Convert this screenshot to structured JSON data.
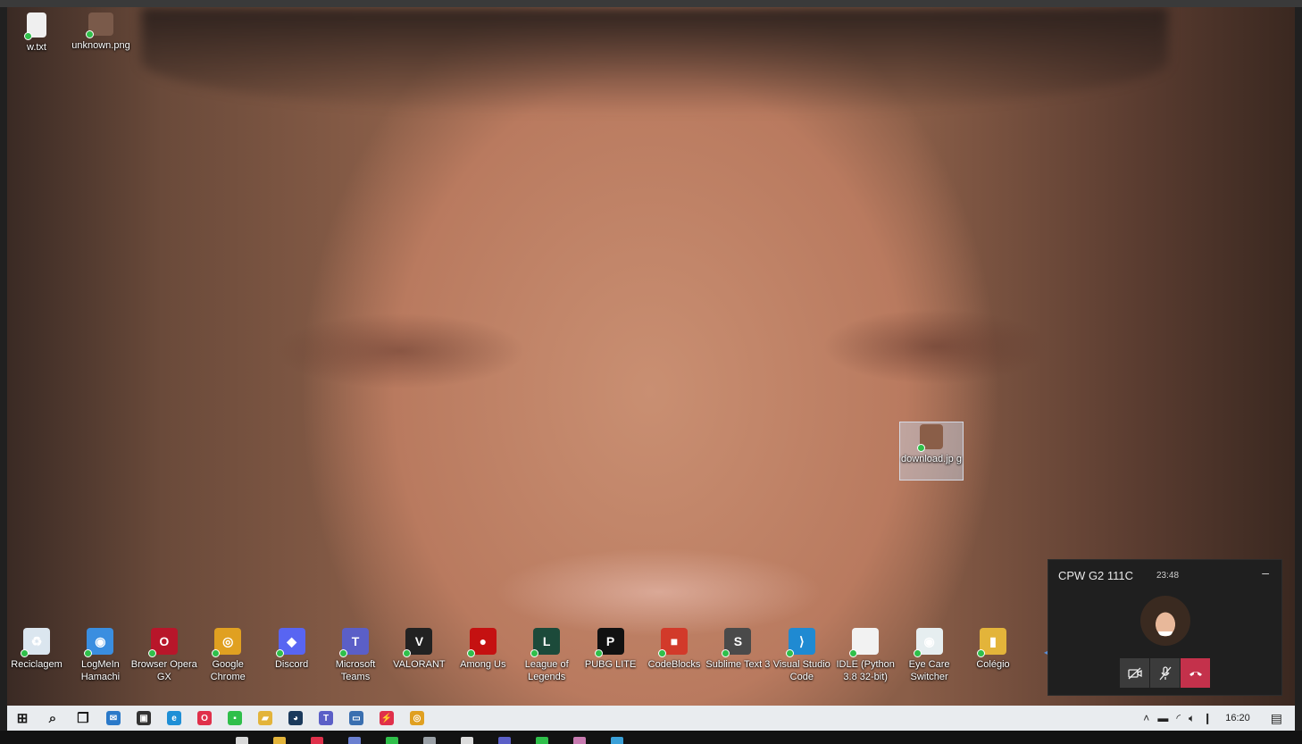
{
  "desktop": {
    "top_icons": [
      {
        "label": "w.txt",
        "icon": "text-file-icon",
        "color": "#e8e8e8"
      },
      {
        "label": "unknown.png",
        "icon": "image-file-icon",
        "color": "#7a5a4a"
      }
    ],
    "selected_file": {
      "label": "download.jp g",
      "icon": "image-file-icon"
    },
    "bottom_icons": [
      {
        "label": "Reciclagem",
        "icon": "recycle-bin-icon",
        "color": "#dbe6ef",
        "glyph": "♻"
      },
      {
        "label": "LogMeIn Hamachi",
        "icon": "hamachi-icon",
        "color": "#3a8ee0",
        "glyph": "◉"
      },
      {
        "label": "Browser Opera GX",
        "icon": "opera-gx-icon",
        "color": "#b8162a",
        "glyph": "O"
      },
      {
        "label": "Google Chrome",
        "icon": "chrome-icon",
        "color": "#e0a021",
        "glyph": "◎"
      },
      {
        "label": "Discord",
        "icon": "discord-icon",
        "color": "#5865f2",
        "glyph": "◆"
      },
      {
        "label": "Microsoft Teams",
        "icon": "teams-icon",
        "color": "#5b5fc7",
        "glyph": "T"
      },
      {
        "label": "VALORANT",
        "icon": "valorant-icon",
        "color": "#222222",
        "glyph": "V"
      },
      {
        "label": "Among Us",
        "icon": "among-us-icon",
        "color": "#c51111",
        "glyph": "●"
      },
      {
        "label": "League of Legends",
        "icon": "league-icon",
        "color": "#1c4a3a",
        "glyph": "L"
      },
      {
        "label": "PUBG LITE",
        "icon": "pubg-icon",
        "color": "#111111",
        "glyph": "P"
      },
      {
        "label": "CodeBlocks",
        "icon": "codeblocks-icon",
        "color": "#d23a2a",
        "glyph": "■"
      },
      {
        "label": "Sublime Text 3",
        "icon": "sublime-icon",
        "color": "#4a4a4a",
        "glyph": "S"
      },
      {
        "label": "Visual Studio Code",
        "icon": "vscode-icon",
        "color": "#1f8ad2",
        "glyph": "⟩"
      },
      {
        "label": "IDLE (Python 3.8 32-bit)",
        "icon": "python-file-icon",
        "color": "#f2f2f2",
        "glyph": ""
      },
      {
        "label": "Eye Care Switcher",
        "icon": "eye-care-icon",
        "color": "#e6eef0",
        "glyph": "◉"
      },
      {
        "label": "Colégio",
        "icon": "folder-icon",
        "color": "#e3b43a",
        "glyph": "▮"
      }
    ]
  },
  "taskbar": {
    "items": [
      {
        "icon": "windows-start-icon",
        "color": "#1a1a1a",
        "glyph": "⊞"
      },
      {
        "icon": "search-icon",
        "color": "#1a1a1a",
        "glyph": "⌕"
      },
      {
        "icon": "task-view-icon",
        "color": "#1a1a1a",
        "glyph": "❒"
      },
      {
        "icon": "mail-icon",
        "color": "#2a79c9",
        "glyph": "✉"
      },
      {
        "icon": "store-icon",
        "color": "#333333",
        "glyph": "▣"
      },
      {
        "icon": "edge-icon",
        "color": "#1e8fd6",
        "glyph": "e"
      },
      {
        "icon": "opera-icon",
        "color": "#e0304a",
        "glyph": "O"
      },
      {
        "icon": "app-green-icon",
        "color": "#2fbf4a",
        "glyph": "▪"
      },
      {
        "icon": "file-explorer-icon",
        "color": "#e3b43a",
        "glyph": "▰"
      },
      {
        "icon": "steam-icon",
        "color": "#1b3a5c",
        "glyph": "◕"
      },
      {
        "icon": "teams-icon",
        "color": "#5b5fc7",
        "glyph": "T"
      },
      {
        "icon": "screen-icon",
        "color": "#3a6fb0",
        "glyph": "▭"
      },
      {
        "icon": "flash-icon",
        "color": "#e0304a",
        "glyph": "⚡"
      },
      {
        "icon": "chrome-icon",
        "color": "#e0a021",
        "glyph": "◎"
      }
    ],
    "tray": {
      "chevron": "˄",
      "time": "16:20"
    }
  },
  "call": {
    "title": "CPW G2 111C",
    "duration": "23:48",
    "minimize": "–"
  },
  "bottom_strip_colors": [
    "#d8d8d8",
    "#e3b43a",
    "#e0304a",
    "#6a7fd0",
    "#2fbf4a",
    "#9aa0a6",
    "#dcdcdc",
    "#5b5fc7",
    "#2fbf4a",
    "#c87ab0",
    "#3aa0d8"
  ]
}
